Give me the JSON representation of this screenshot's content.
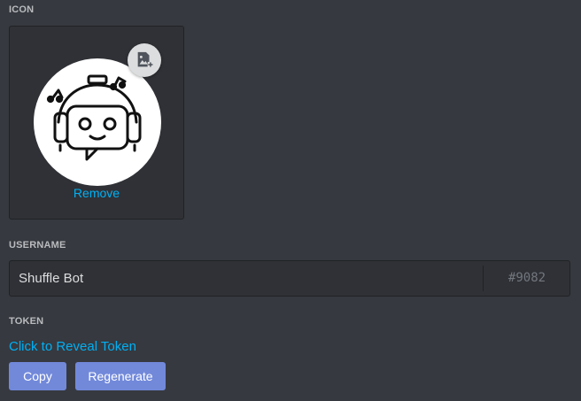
{
  "icon_section": {
    "label": "ICON",
    "avatar": "robot-headphones-avatar",
    "upload_icon": "image-add-icon",
    "remove_label": "Remove"
  },
  "username_section": {
    "label": "USERNAME",
    "username_value": "Shuffle Bot",
    "discriminator": "#9082"
  },
  "token_section": {
    "label": "TOKEN",
    "reveal_label": "Click to Reveal Token",
    "copy_label": "Copy",
    "regenerate_label": "Regenerate"
  },
  "colors": {
    "background": "#36393f",
    "panel": "#2f3136",
    "link": "#00b0f4",
    "button": "#7289da",
    "label": "#b9bbbe"
  }
}
